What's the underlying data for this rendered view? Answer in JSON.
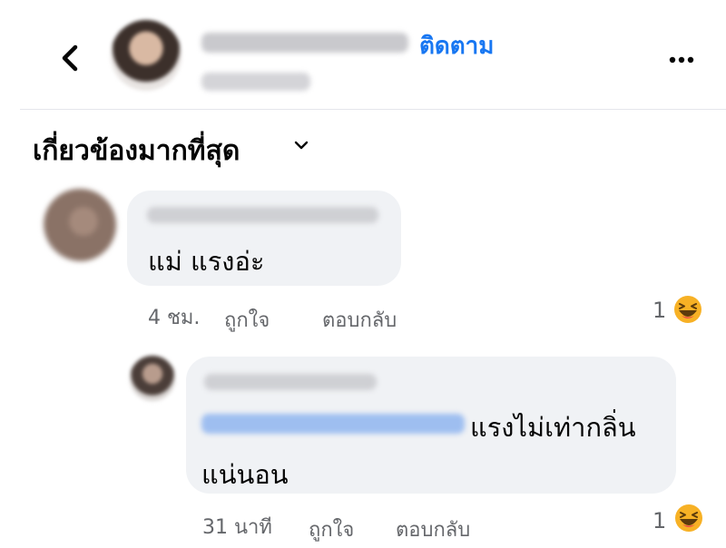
{
  "header": {
    "follow_label": "ติดตาม",
    "back_icon": "chevron-left-icon",
    "more_icon": "more-horizontal-icon"
  },
  "sort": {
    "label": "เกี่ยวข้องมากที่สุด",
    "icon": "chevron-down-icon"
  },
  "comments": [
    {
      "text": "แม่ แรงอ่ะ",
      "time": "4 ชม.",
      "like_label": "ถูกใจ",
      "reply_label": "ตอบกลับ",
      "reaction_count": "1",
      "reaction_icon": "laughing-emoji-icon"
    },
    {
      "text_line1": "แรงไม่เท่ากลิ่น",
      "text_line2": "แน่นอน",
      "time": "31 นาที",
      "like_label": "ถูกใจ",
      "reply_label": "ตอบกลับ",
      "reaction_count": "1",
      "reaction_icon": "laughing-emoji-icon"
    }
  ],
  "colors": {
    "accent": "#1877f2",
    "bubble": "#f0f2f5",
    "meta": "#65676b",
    "reaction": "#f7b125"
  }
}
